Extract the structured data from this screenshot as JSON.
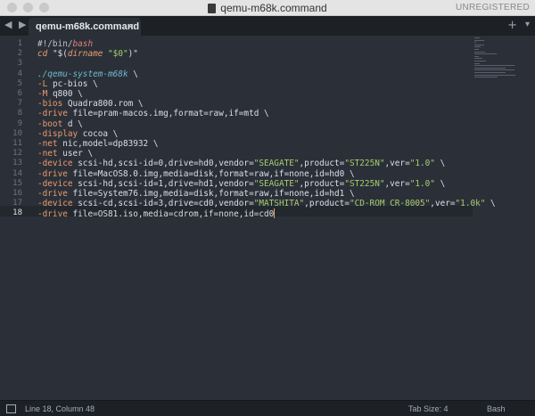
{
  "window": {
    "title": "qemu-m68k.command",
    "registration": "UNREGISTERED"
  },
  "tabbar": {
    "nav_arrows": "◀ ▶",
    "tab_label": "qemu-m68k.command",
    "tab_close": "×",
    "plus": "+",
    "dropdown": "▾"
  },
  "editor": {
    "line_numbers": [
      "1",
      "2",
      "3",
      "4",
      "5",
      "6",
      "7",
      "8",
      "9",
      "10",
      "11",
      "12",
      "13",
      "14",
      "15",
      "16",
      "17",
      "18"
    ],
    "active_line": 18,
    "lines": [
      [
        {
          "t": "#!/bin/",
          "c": "kw"
        },
        {
          "t": "bash",
          "c": "italic"
        }
      ],
      [
        {
          "t": "cd ",
          "c": "cmd"
        },
        {
          "t": "\"$(",
          "c": "punct"
        },
        {
          "t": "dirname",
          "c": "cmd"
        },
        {
          "t": " \"$0\"",
          "c": "str"
        },
        {
          "t": ")\"",
          "c": "punct"
        }
      ],
      [
        {
          "t": "",
          "c": "punct"
        }
      ],
      [
        {
          "t": "./qemu-system-m68k",
          "c": "path"
        },
        {
          "t": " \\",
          "c": "punct"
        }
      ],
      [
        {
          "t": "-L",
          "c": "flag"
        },
        {
          "t": " pc-bios \\",
          "c": "punct"
        }
      ],
      [
        {
          "t": "-M",
          "c": "flag"
        },
        {
          "t": " q800 \\",
          "c": "punct"
        }
      ],
      [
        {
          "t": "-bios",
          "c": "flag"
        },
        {
          "t": " Quadra800.rom \\",
          "c": "punct"
        }
      ],
      [
        {
          "t": "-drive",
          "c": "flag"
        },
        {
          "t": " file=pram-macos.img,format=raw,if=mtd \\",
          "c": "punct"
        }
      ],
      [
        {
          "t": "-boot",
          "c": "flag"
        },
        {
          "t": " d \\",
          "c": "punct"
        }
      ],
      [
        {
          "t": "-display",
          "c": "flag"
        },
        {
          "t": " cocoa \\",
          "c": "punct"
        }
      ],
      [
        {
          "t": "-net",
          "c": "flag"
        },
        {
          "t": " nic,model=dp83932 \\",
          "c": "punct"
        }
      ],
      [
        {
          "t": "-net",
          "c": "flag"
        },
        {
          "t": " user \\",
          "c": "punct"
        }
      ],
      [
        {
          "t": "-device",
          "c": "flag"
        },
        {
          "t": " scsi-hd,scsi-id=0,drive=hd0,vendor=",
          "c": "punct"
        },
        {
          "t": "\"SEAGATE\"",
          "c": "str"
        },
        {
          "t": ",product=",
          "c": "punct"
        },
        {
          "t": "\"ST225N\"",
          "c": "str"
        },
        {
          "t": ",ver=",
          "c": "punct"
        },
        {
          "t": "\"1.0\"",
          "c": "str"
        },
        {
          "t": " \\",
          "c": "punct"
        }
      ],
      [
        {
          "t": "-drive",
          "c": "flag"
        },
        {
          "t": " file=MacOS8.0.img,media=disk,format=raw,if=none,id=hd0 \\",
          "c": "punct"
        }
      ],
      [
        {
          "t": "-device",
          "c": "flag"
        },
        {
          "t": " scsi-hd,scsi-id=1,drive=hd1,vendor=",
          "c": "punct"
        },
        {
          "t": "\"SEAGATE\"",
          "c": "str"
        },
        {
          "t": ",product=",
          "c": "punct"
        },
        {
          "t": "\"ST225N\"",
          "c": "str"
        },
        {
          "t": ",ver=",
          "c": "punct"
        },
        {
          "t": "\"1.0\"",
          "c": "str"
        },
        {
          "t": " \\",
          "c": "punct"
        }
      ],
      [
        {
          "t": "-drive",
          "c": "flag"
        },
        {
          "t": " file=System76.img,media=disk,format=raw,if=none,id=hd1 \\",
          "c": "punct"
        }
      ],
      [
        {
          "t": "-device",
          "c": "flag"
        },
        {
          "t": " scsi-cd,scsi-id=3,drive=cd0,vendor=",
          "c": "punct"
        },
        {
          "t": "\"MATSHITA\"",
          "c": "str"
        },
        {
          "t": ",product=",
          "c": "punct"
        },
        {
          "t": "\"CD-ROM CR-8005\"",
          "c": "str"
        },
        {
          "t": ",ver=",
          "c": "punct"
        },
        {
          "t": "\"1.0k\"",
          "c": "str"
        },
        {
          "t": " \\",
          "c": "punct"
        }
      ],
      [
        {
          "t": "-drive",
          "c": "flag"
        },
        {
          "t": " file=OS81.iso,media=cdrom,if=none,id=cd0",
          "c": "punct"
        }
      ]
    ]
  },
  "statusbar": {
    "position": "Line 18, Column 48",
    "tab_size": "Tab Size: 4",
    "syntax": "Bash"
  }
}
